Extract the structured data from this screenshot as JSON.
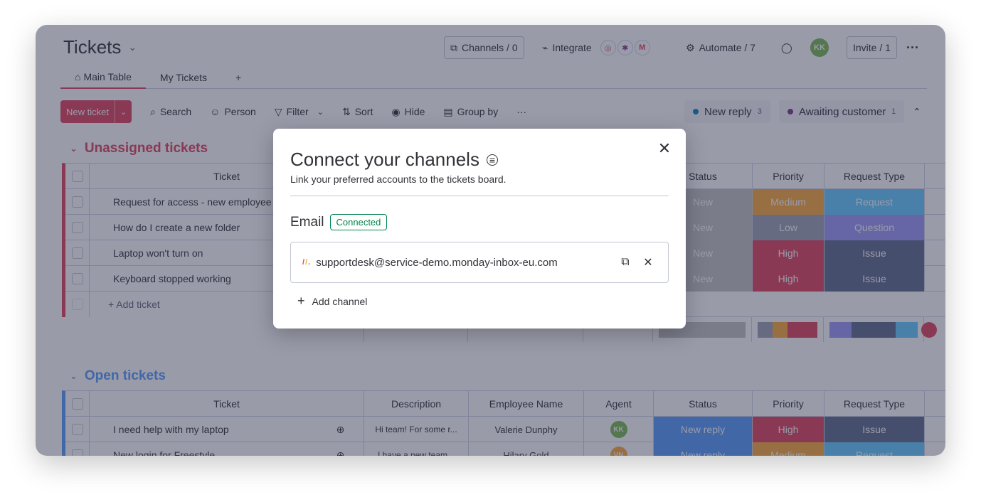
{
  "board": {
    "title": "Tickets",
    "header": {
      "channels": "Channels / 0",
      "integrate": "Integrate",
      "automate": "Automate / 7",
      "user_initials": "KK",
      "invite": "Invite / 1",
      "more": "···"
    },
    "tabs": [
      {
        "label": "Main Table"
      },
      {
        "label": "My Tickets"
      },
      {
        "label": "+"
      }
    ],
    "toolbar": {
      "new_ticket": "New ticket",
      "search": "Search",
      "person": "Person",
      "filter": "Filter",
      "sort": "Sort",
      "hide": "Hide",
      "group_by": "Group by",
      "more": "···"
    },
    "chips": [
      {
        "label": "New reply",
        "count": "3",
        "color": "#0086c0"
      },
      {
        "label": "Awaiting customer",
        "count": "1",
        "color": "#7e3b8a"
      }
    ],
    "groups": [
      {
        "title": "Unassigned tickets",
        "color": "#e2445c",
        "columns": [
          "Ticket",
          "Status",
          "Priority",
          "Request Type"
        ],
        "rows": [
          {
            "ticket": "Request for access - new employee",
            "status": "New",
            "priority": "Medium",
            "request_type": "Request"
          },
          {
            "ticket": "How do I create a new folder",
            "status": "New",
            "priority": "Low",
            "request_type": "Question"
          },
          {
            "ticket": "Laptop won't turn on",
            "status": "New",
            "priority": "High",
            "request_type": "Issue"
          },
          {
            "ticket": "Keyboard stopped working",
            "status": "New",
            "priority": "High",
            "request_type": "Issue"
          }
        ],
        "add_label": "+ Add ticket"
      },
      {
        "title": "Open tickets",
        "color": "#579bfc",
        "columns": [
          "Ticket",
          "Description",
          "Employee Name",
          "Agent",
          "Status",
          "Priority",
          "Request Type"
        ],
        "rows": [
          {
            "ticket": "I need help with my laptop",
            "description": "Hi team! For some r...",
            "employee": "Valerie Dunphy",
            "agent": "KK",
            "status": "New reply",
            "priority": "High",
            "request_type": "Issue"
          },
          {
            "ticket": "New login for Freestyle",
            "description": "I have a new team...",
            "employee": "Hilary Gold",
            "agent": "VN",
            "status": "New reply",
            "priority": "Medium",
            "request_type": "Request"
          }
        ]
      }
    ],
    "colors": {
      "new": "#c4c4c4",
      "new_reply": "#579bfc",
      "medium": "#fdab3d",
      "low": "#a0a3b5",
      "high": "#e2445c",
      "request": "#66ccff",
      "question": "#9d99f9",
      "issue": "#5e6b8a"
    }
  },
  "modal": {
    "title": "Connect your channels",
    "subtitle": "Link your preferred accounts to the tickets board.",
    "section_label": "Email",
    "badge": "Connected",
    "email": "supportdesk@service-demo.monday-inbox-eu.com",
    "add_channel": "Add channel"
  }
}
